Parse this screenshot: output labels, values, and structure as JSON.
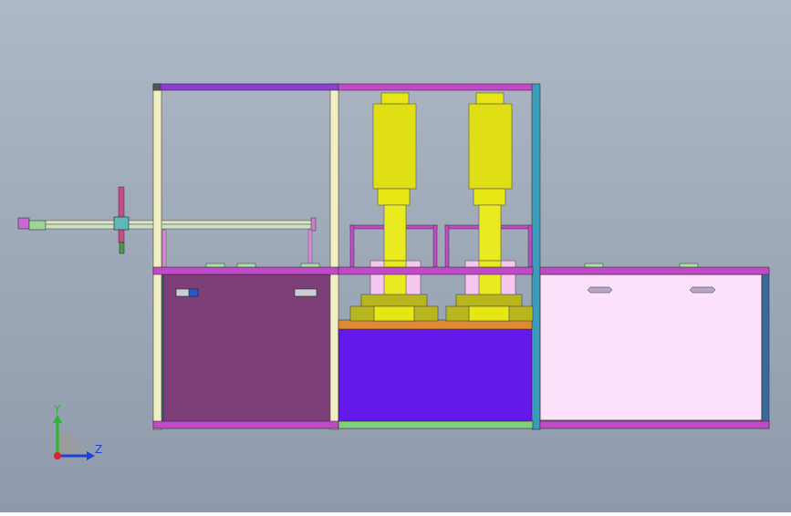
{
  "viewport": {
    "background_top": "#aeb8c6",
    "background_bottom": "#8e9aab"
  },
  "axis_triad": {
    "y_label": "Y",
    "z_label": "Z",
    "y_color": "#2ab82a",
    "z_color": "#1e3fd8",
    "x_color": "#d8232a"
  },
  "colors": {
    "frame_magenta": "#c04ac8",
    "frame_purple": "#8a3fd0",
    "frame_cream": "#f3efc4",
    "frame_teal": "#3a9cb8",
    "frame_green": "#7fd07a",
    "panel_left": "#7d3f78",
    "panel_middle": "#6418ea",
    "panel_right": "#fde0fa",
    "welder_yellow": "#e6e614",
    "base_olive": "#b8b61e",
    "table_orange": "#e08a32",
    "fixture_pink": "#f6c6f0"
  },
  "icons": [
    "gantry-motor-icon",
    "axis-triad-icon"
  ]
}
